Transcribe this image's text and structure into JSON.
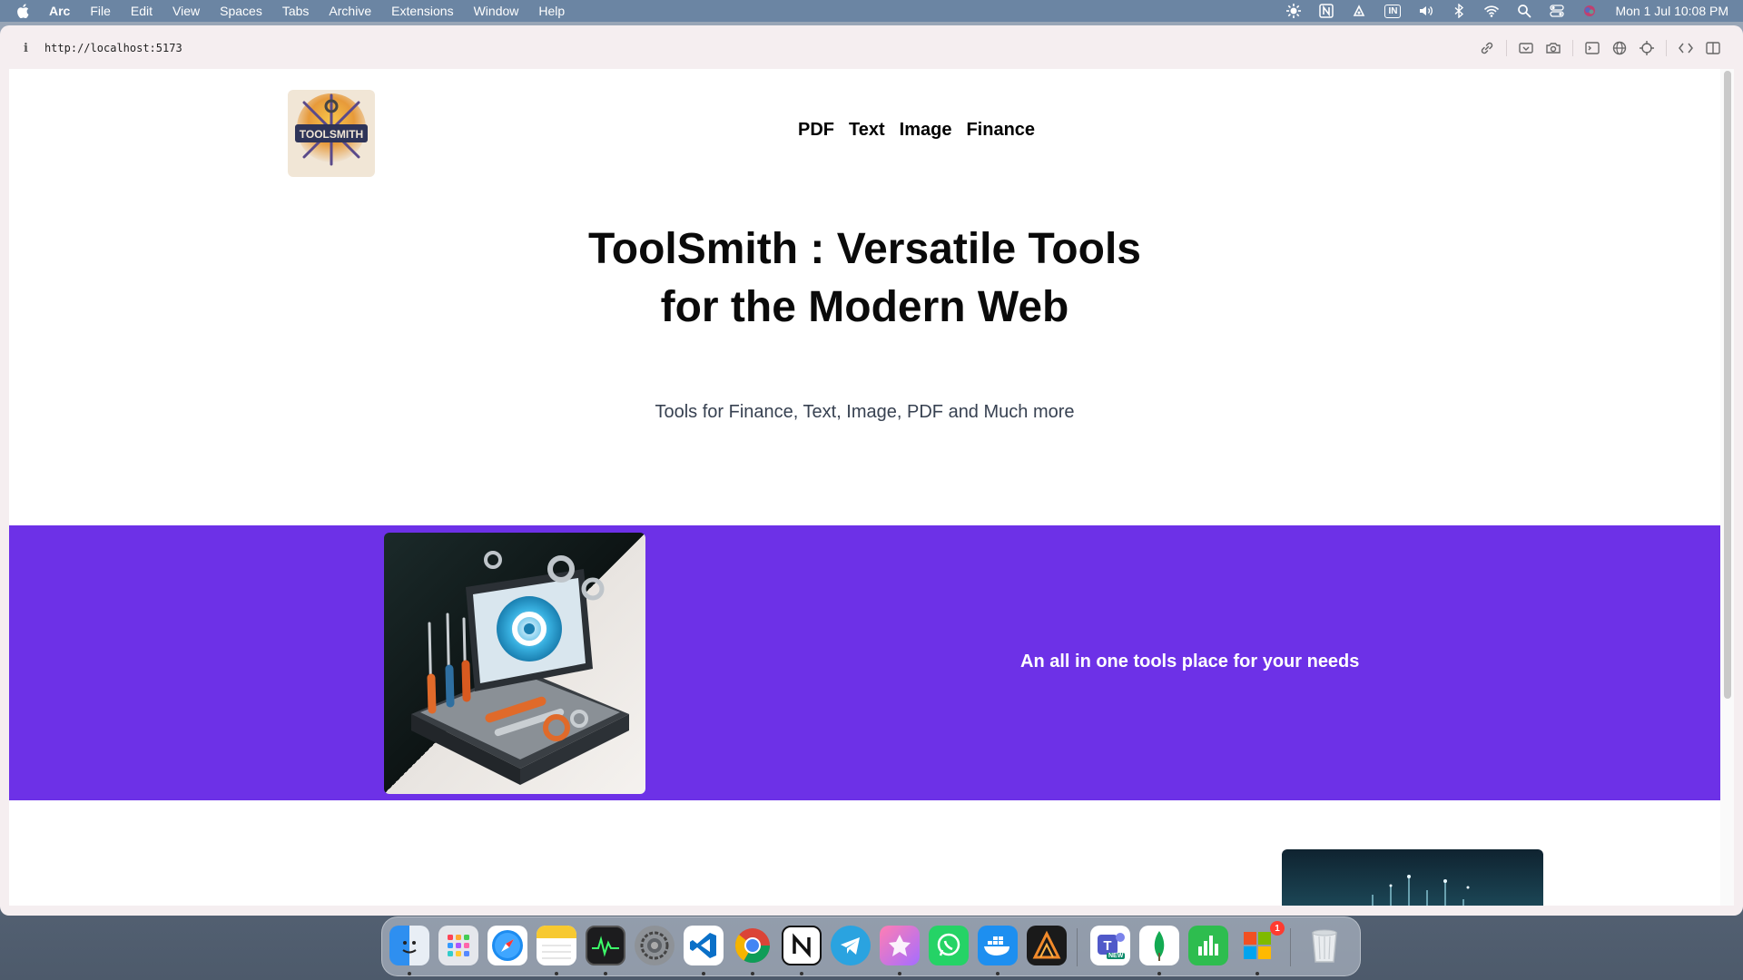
{
  "menubar": {
    "app_name": "Arc",
    "menu_items": [
      "File",
      "Edit",
      "View",
      "Spaces",
      "Tabs",
      "Archive",
      "Extensions",
      "Window",
      "Help"
    ],
    "input_source": "IN",
    "clock": "Mon 1 Jul  10:08 PM"
  },
  "browser": {
    "url": "http://localhost:5173"
  },
  "site": {
    "logo_text": "TOOLSMITH",
    "nav": [
      "PDF",
      "Text",
      "Image",
      "Finance"
    ],
    "hero_title_line1": "ToolSmith : Versatile Tools",
    "hero_title_line2": "for the Modern Web",
    "hero_subtitle": "Tools for Finance, Text, Image, PDF and Much more",
    "band_text": "An all in one tools place for your needs",
    "band_color": "#6d31e7"
  },
  "dock": {
    "apps": [
      "Finder",
      "Launchpad",
      "Safari",
      "Notes",
      "Activity Monitor",
      "System Settings",
      "Visual Studio Code",
      "Google Chrome",
      "Notion",
      "Telegram",
      "Craft",
      "WhatsApp",
      "Docker",
      "Affinity",
      "Microsoft Teams",
      "MongoDB Compass",
      "Numbers",
      "Microsoft Office",
      "Trash"
    ],
    "teams_label": "NEW",
    "office_badge": "1"
  }
}
